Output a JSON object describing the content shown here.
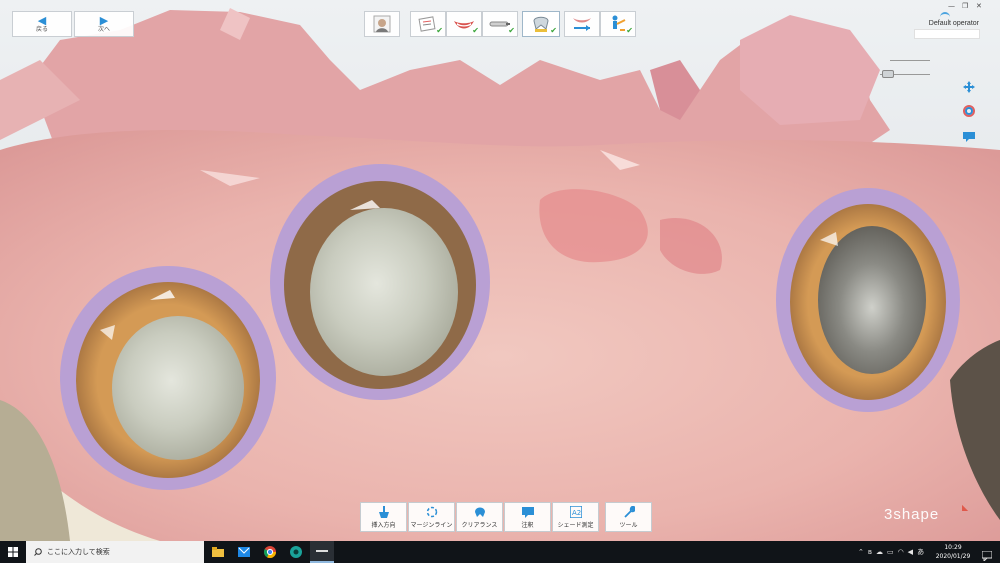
{
  "nav": {
    "back_label": "戻る",
    "next_label": "次へ",
    "back_icon": "arrow-left-icon",
    "next_icon": "arrow-right-icon"
  },
  "workflow_steps": [
    {
      "name": "patient",
      "icon": "patient-portrait-icon",
      "completed": false
    },
    {
      "name": "order-form",
      "icon": "order-form-icon",
      "completed": true
    },
    {
      "name": "smile",
      "icon": "smile-icon",
      "completed": true
    },
    {
      "name": "scan-tool",
      "icon": "scanner-tip-icon",
      "completed": true
    },
    {
      "name": "scan",
      "icon": "tooth-scan-icon",
      "completed": true,
      "active": true
    },
    {
      "name": "design",
      "icon": "teeth-arrow-icon",
      "completed": false
    },
    {
      "name": "send",
      "icon": "person-send-icon",
      "completed": true
    }
  ],
  "operator": {
    "label": "Default operator",
    "value": ""
  },
  "window": {
    "minimize": "—",
    "restore": "❐",
    "close": "✕"
  },
  "side_tools": [
    {
      "name": "move-view",
      "icon": "move-arrows-icon"
    },
    {
      "name": "texture",
      "icon": "color-wheel-icon"
    },
    {
      "name": "annotation",
      "icon": "comment-icon"
    }
  ],
  "tools": [
    {
      "id": "insertion",
      "label": "挿入方向",
      "icon": "insertion-direction-icon"
    },
    {
      "id": "margin",
      "label": "マージンライン",
      "icon": "margin-line-icon"
    },
    {
      "id": "clearance",
      "label": "クリアランス",
      "icon": "clearance-icon"
    },
    {
      "id": "note",
      "label": "注釈",
      "icon": "note-icon"
    },
    {
      "id": "shade",
      "label": "シェード測定",
      "icon": "shade-icon"
    },
    {
      "id": "tools",
      "label": "ツール",
      "icon": "wrench-icon"
    }
  ],
  "brand": {
    "name": "3shape"
  },
  "taskbar": {
    "search_placeholder": "ここに入力して検索",
    "apps": [
      "file-explorer-icon",
      "mail-icon",
      "chrome-icon",
      "app-teal-icon",
      "app-dark-icon"
    ],
    "tray": [
      "chevron-up-icon",
      "bluetooth-icon",
      "cloud-icon",
      "battery-icon",
      "wifi-icon",
      "volume-icon",
      "ime-icon"
    ],
    "tray_ime": "あ",
    "time": "10:29",
    "date": "2020/01/29"
  },
  "colors": {
    "accent": "#2b8fd6",
    "check": "#3aa53a",
    "gingiva": "#e3a9a8",
    "margin_line": "#b9a3d8"
  }
}
